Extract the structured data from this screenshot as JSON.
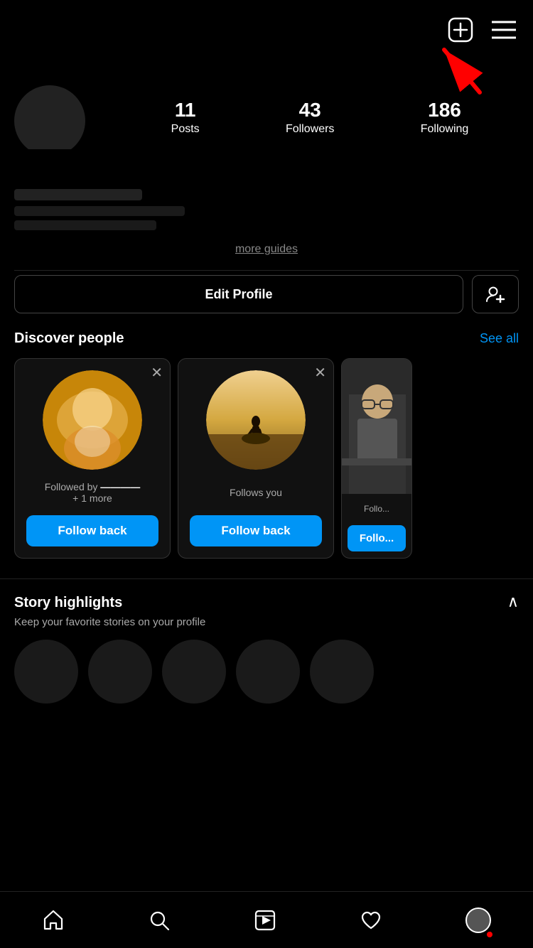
{
  "header": {
    "new_post_icon": "⊕",
    "menu_icon": "☰"
  },
  "stats": {
    "posts_count": "11",
    "posts_label": "Posts",
    "followers_count": "43",
    "followers_label": "Followers",
    "following_count": "186",
    "following_label": "Following"
  },
  "profile": {
    "more_guides": "more guides",
    "edit_profile_label": "Edit Profile",
    "add_friend_label": "+"
  },
  "discover": {
    "title": "Discover people",
    "see_all": "See all",
    "people": [
      {
        "follow_info_line1": "Followed by",
        "follow_info_line2": "+ 1 more",
        "follow_back_label": "Follow back"
      },
      {
        "follow_info_line1": "Follows you",
        "follow_info_line2": "",
        "follow_back_label": "Follow back"
      },
      {
        "follow_info_line1": "Follo...",
        "follow_info_line2": "",
        "follow_back_label": "Follo..."
      }
    ]
  },
  "story": {
    "title": "Story highlights",
    "chevron_up": "∧",
    "subtitle": "Keep your favorite stories on your profile"
  },
  "bottom_nav": {
    "home_icon": "home",
    "search_icon": "search",
    "reels_icon": "reels",
    "heart_icon": "heart",
    "profile_icon": "profile"
  }
}
